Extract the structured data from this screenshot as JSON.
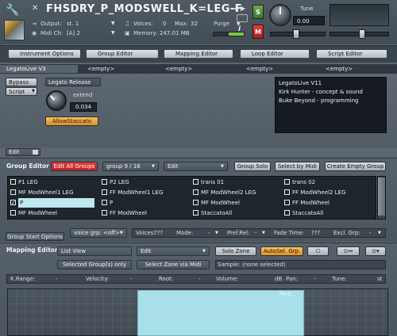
{
  "header": {
    "instrument_name": "FHSDRY_P_MODSWELL_K=LEG-F",
    "output_label": "Output:",
    "output_value": "st. 1",
    "midi_label": "Midi Ch:",
    "midi_value": "[A] 2",
    "voices_label": "Voices:",
    "voices_value": "0",
    "max_label": "Max:",
    "max_value": "32",
    "memory_label": "Memory:",
    "memory_value": "247.01 MB",
    "purge_label": "Purge",
    "s_label": "S",
    "m_label": "M",
    "tune_label": "Tune",
    "tune_value": "0.00"
  },
  "editor_tabs": [
    "Instrument Options",
    "Group Editor",
    "Mapping Editor",
    "Loop Editor",
    "Script Editor"
  ],
  "script_slots": [
    "LegatoLive V3",
    "<empty>",
    "<empty>",
    "<empty>",
    "<empty>"
  ],
  "script": {
    "bypass": "Bypass",
    "script_menu": "Script",
    "title": "Legato Release",
    "extend_label": "extend",
    "extend_value": "0.034",
    "allow_staccato": "AllowStaccato",
    "info_lines": [
      "LegatoLive V11",
      "Kirk Hunter - concept & sound",
      "Buke Beyond - programming"
    ],
    "edit": "Edit"
  },
  "group_editor": {
    "title": "Group Editor",
    "edit_all": "Edit All Groups",
    "group_count": "group 9 / 16",
    "edit_menu": "Edit",
    "group_solo": "Group Solo",
    "select_by_midi": "Select by Midi",
    "create_empty": "Create Empty Group",
    "groups": [
      [
        "P1 LEG",
        "P2 LEG",
        "trans 01",
        "trans 02"
      ],
      [
        "MF ModWheel1 LEG",
        "FF ModWheel1 LEG",
        "MF ModWheel2 LEG",
        "FF ModWheel2 LEG"
      ],
      [
        "P",
        "P",
        "MF ModWheel",
        "FF ModWheel"
      ],
      [
        "MF ModWheel",
        "FF ModWheel",
        "StaccatoAll",
        "StaccatoAll"
      ]
    ],
    "start_options": "Group Start Options",
    "voice_grp": "voice grp. <off>",
    "voices_label": "Voices:",
    "voices_value": "???",
    "mode_label": "Mode:",
    "mode_value": "-",
    "pref_rel_label": "Pref.Rel:",
    "pref_rel_value": "-",
    "fade_time_label": "Fade Time:",
    "fade_time_value": "???",
    "excl_grp_label": "Excl. Grp:",
    "excl_grp_value": "-"
  },
  "mapping_editor": {
    "title": "Mapping Editor",
    "list_view": "List View",
    "edit_menu": "Edit",
    "solo_zone": "Solo Zone",
    "auto_sel": "AutoSel. Grp.",
    "selected_groups": "Selected Group(s) only",
    "select_zone_midi": "Select Zone via Midi",
    "sample_label": "Sample:",
    "sample_value": "(none selected)",
    "params": [
      {
        "label": "K.Range:",
        "value": "-"
      },
      {
        "label": "Velocity:",
        "value": "-"
      },
      {
        "label": "Root:",
        "value": "-"
      },
      {
        "label": "Volume:",
        "value": "dB"
      },
      {
        "label": "Pan:",
        "value": "-"
      },
      {
        "label": "Tune:",
        "value": "st"
      }
    ],
    "zone_label": "FH-S..."
  },
  "colors": {
    "edit_all_red": "#d42a2a",
    "staccato_orange": "#f0a23a",
    "autosel_orange": "#f5a53a",
    "zone_cyan": "#a9dfe8",
    "mute_red": "#c8262a",
    "solo_green": "#4f8a3a"
  }
}
